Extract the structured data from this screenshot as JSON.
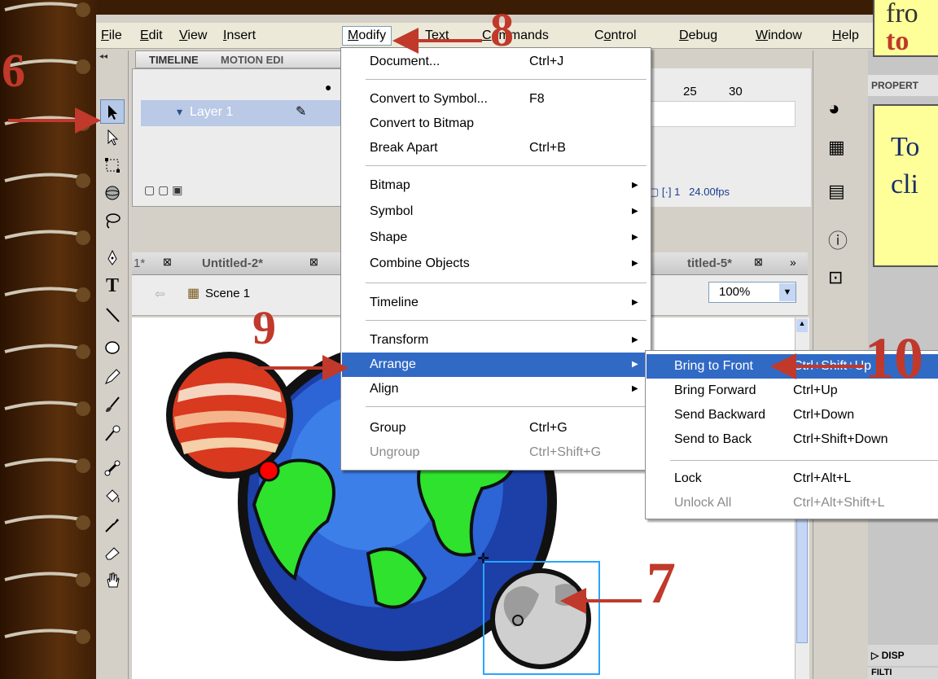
{
  "menubar": {
    "items": [
      {
        "label": "File",
        "ul": "F",
        "rest": "ile"
      },
      {
        "label": "Edit",
        "ul": "E",
        "rest": "dit"
      },
      {
        "label": "View",
        "ul": "V",
        "rest": "iew"
      },
      {
        "label": "Insert",
        "ul": "I",
        "rest": "nsert"
      },
      {
        "label": "Modify",
        "ul": "M",
        "rest": "odify"
      },
      {
        "label": "Text",
        "ul": "T",
        "rest": "ext"
      },
      {
        "label": "Commands",
        "ul": "C",
        "rest": "ommands"
      },
      {
        "label": "Control",
        "ul": "o",
        "rest": "ntrol"
      },
      {
        "label": "Debug",
        "ul": "D",
        "rest": "ebug"
      },
      {
        "label": "Window",
        "ul": "W",
        "rest": "indow"
      },
      {
        "label": "Help",
        "ul": "H",
        "rest": "elp"
      }
    ]
  },
  "timeline": {
    "tab_timeline": "TIMELINE",
    "tab_motion": "MOTION EDI",
    "layer_name": "Layer 1",
    "frame_25": "25",
    "frame_30": "30",
    "current_frame": "1",
    "fps": "24.00",
    "fps_unit": "fps"
  },
  "doc_tabs": [
    "1*",
    "Untitled-2*",
    "titled-5*"
  ],
  "editbar": {
    "scene": "Scene 1",
    "zoom": "100%"
  },
  "modify_menu": {
    "document": {
      "label": "Document...",
      "shortcut": "Ctrl+J"
    },
    "convert_symbol": {
      "label": "Convert to Symbol...",
      "shortcut": "F8"
    },
    "convert_bitmap": {
      "label": "Convert to Bitmap"
    },
    "break_apart": {
      "label": "Break Apart",
      "shortcut": "Ctrl+B"
    },
    "bitmap": {
      "label": "Bitmap"
    },
    "symbol": {
      "label": "Symbol"
    },
    "shape": {
      "label": "Shape"
    },
    "combine": {
      "label": "Combine Objects"
    },
    "timeline": {
      "label": "Timeline"
    },
    "transform": {
      "label": "Transform"
    },
    "arrange": {
      "label": "Arrange"
    },
    "align": {
      "label": "Align"
    },
    "group": {
      "label": "Group",
      "shortcut": "Ctrl+G"
    },
    "ungroup": {
      "label": "Ungroup",
      "shortcut": "Ctrl+Shift+G"
    }
  },
  "arrange_menu": {
    "bring_front": {
      "label": "Bring to Front",
      "shortcut": "Ctrl+Shift+Up"
    },
    "bring_forward": {
      "label": "Bring Forward",
      "shortcut": "Ctrl+Up"
    },
    "send_backward": {
      "label": "Send Backward",
      "shortcut": "Ctrl+Down"
    },
    "send_back": {
      "label": "Send to Back",
      "shortcut": "Ctrl+Shift+Down"
    },
    "lock": {
      "label": "Lock",
      "shortcut": "Ctrl+Alt+L"
    },
    "unlock_all": {
      "label": "Unlock All",
      "shortcut": "Ctrl+Alt+Shift+L"
    }
  },
  "properties": {
    "header": "PROPERT",
    "display": "DISP",
    "filters": "FILTI"
  },
  "annotations": {
    "step6": "6",
    "step7": "7",
    "step8": "8",
    "step9": "9",
    "step10": "10",
    "callout_top_line1": "fro",
    "callout_top_line2": "to",
    "callout_mid_line1": "To",
    "callout_mid_line2": "cli"
  },
  "colors": {
    "menu_highlight": "#316ac5",
    "annotation_red": "#c0392b",
    "callout_yellow": "#ffff99"
  }
}
